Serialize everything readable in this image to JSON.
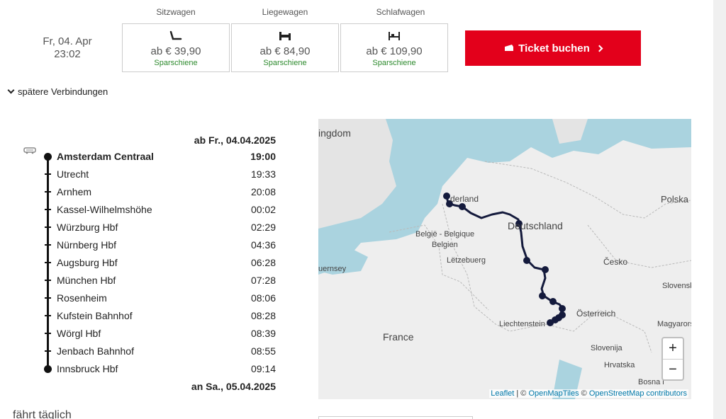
{
  "classes": {
    "labels": [
      "Sitzwagen",
      "Liegewagen",
      "Schlafwagen"
    ],
    "boxes": [
      {
        "price": "ab € 39,90",
        "tag": "Sparschiene",
        "icon": "seat-icon"
      },
      {
        "price": "ab € 84,90",
        "tag": "Sparschiene",
        "icon": "couchette-icon"
      },
      {
        "price": "ab € 109,90",
        "tag": "Sparschiene",
        "icon": "bed-icon"
      }
    ]
  },
  "departure": {
    "date": "Fr, 04. Apr",
    "time": "23:02"
  },
  "book_button": {
    "label": "Ticket buchen",
    "icon": "ticket-icon",
    "color": "#e3001b"
  },
  "later_connections": "spätere Verbindungen",
  "itinerary": {
    "departure_header": "ab Fr., 04.04.2025",
    "arrival_header": "an Sa., 05.04.2025",
    "stops": [
      {
        "name": "Amsterdam Centraal",
        "time": "19:00"
      },
      {
        "name": "Utrecht",
        "time": "19:33"
      },
      {
        "name": "Arnhem",
        "time": "20:08"
      },
      {
        "name": "Kassel-Wilhelmshöhe",
        "time": "00:02"
      },
      {
        "name": "Würzburg Hbf",
        "time": "02:29"
      },
      {
        "name": "Nürnberg Hbf",
        "time": "04:36"
      },
      {
        "name": "Augsburg Hbf",
        "time": "06:28"
      },
      {
        "name": "München Hbf",
        "time": "07:28"
      },
      {
        "name": "Rosenheim",
        "time": "08:06"
      },
      {
        "name": "Kufstein Bahnhof",
        "time": "08:28"
      },
      {
        "name": "Wörgl Hbf",
        "time": "08:39"
      },
      {
        "name": "Jenbach Bahnhof",
        "time": "08:55"
      },
      {
        "name": "Innsbruck Hbf",
        "time": "09:14"
      }
    ]
  },
  "frequency": "fährt täglich",
  "map": {
    "labels": {
      "kingdom": "ingdom",
      "nederland": "derland",
      "deutschland": "Deutschland",
      "belgie": "België - Belgique",
      "belgien": "Belgien",
      "letzebuerg": "Lëtzebuerg",
      "guernsey": "uernsey",
      "france": "France",
      "polska": "Polska",
      "cesko": "Česko",
      "slovensko": "Slovensk",
      "osterreich": "Österreich",
      "liechtenstein": "Liechtenstein",
      "magyarorszag": "Magyarors",
      "slovenija": "Slovenija",
      "hrvatska": "Hrvatska",
      "bosna": "Bosna i"
    },
    "zoom_in": "+",
    "zoom_out": "−",
    "attribution": {
      "leaflet": "Leaflet",
      "sep1": " | © ",
      "omt": "OpenMapTiles",
      "sep2": " © ",
      "osm": "OpenStreetMap contributors"
    },
    "route_color": "#141a3c",
    "water_color": "#aad3df"
  }
}
